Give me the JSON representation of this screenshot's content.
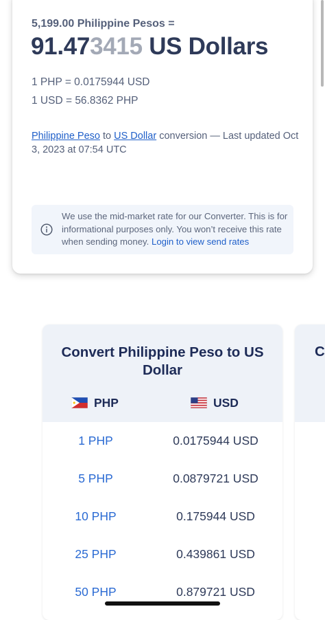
{
  "converter": {
    "from_amount_text": "5,199.00 Philippine Pesos =",
    "result_strong": "91.47",
    "result_faded": "3415",
    "result_currency": " US Dollars",
    "rate_from": "1 PHP = 0.0175944 USD",
    "rate_to": "1 USD = 56.8362 PHP",
    "link_from": "Philippine Peso",
    "to_word": " to ",
    "link_to": "US Dollar",
    "updated_text": " conversion — Last updated Oct 3, 2023 at 07:54 UTC",
    "info_text": "We use the mid-market rate for our Converter. This is for informational purposes only. You won’t receive this rate when sending money. ",
    "info_link": "Login to view send rates",
    "info_icon": "info-circle-icon"
  },
  "table": {
    "title": "Convert Philippine Peso to US Dollar",
    "col_from": "PHP",
    "col_to": "USD",
    "flag_from": "philippines-flag-icon",
    "flag_to": "us-flag-icon",
    "rows": [
      {
        "from": "1 PHP",
        "to": "0.0175944 USD"
      },
      {
        "from": "5 PHP",
        "to": "0.0879721 USD"
      },
      {
        "from": "10 PHP",
        "to": "0.175944 USD"
      },
      {
        "from": "25 PHP",
        "to": "0.439861 USD"
      },
      {
        "from": "50 PHP",
        "to": "0.879721 USD"
      }
    ]
  },
  "next_table": {
    "title_peek": "C"
  },
  "colors": {
    "link": "#1f5fc9",
    "text": "#2e3a59",
    "table_head_bg": "#eef2f8",
    "info_bg": "#f1f5fb"
  }
}
